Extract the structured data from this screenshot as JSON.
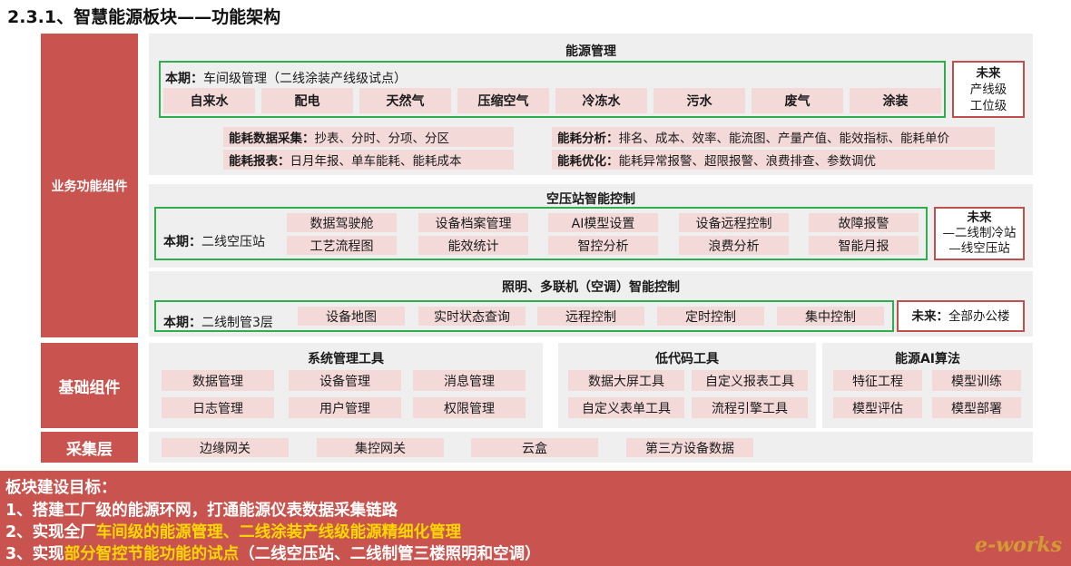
{
  "title": "2.3.1、智慧能源板块——功能架构",
  "side": {
    "business": "业务功能组件",
    "base": "基础组件",
    "collect": "采集层"
  },
  "energy": {
    "header": "能源管理",
    "current_prefix": "本期：",
    "current_text": "车间级管理（二线涂装产线级试点）",
    "items": [
      "自来水",
      "配电",
      "天然气",
      "压缩空气",
      "冷冻水",
      "污水",
      "废气",
      "涂装"
    ],
    "future_title": "未来",
    "future_line1": "产线级",
    "future_line2": "工位级",
    "collect_label": "能耗数据采集：",
    "collect_text": "抄表、分时、分项、分区",
    "report_label": "能耗报表：",
    "report_text": "日月年报、单车能耗、能耗成本",
    "analysis_label": "能耗分析：",
    "analysis_text": "排名、成本、效率、能流图、产量产值、能效指标、能耗单价",
    "optimize_label": "能耗优化：",
    "optimize_text": "能耗异常报警、超限报警、浪费排查、参数调优"
  },
  "air": {
    "header": "空压站智能控制",
    "current_prefix": "本期：",
    "current_text": "二线空压站",
    "row1": [
      "数据驾驶舱",
      "设备档案管理",
      "AI模型设置",
      "设备远程控制",
      "故障报警"
    ],
    "row2": [
      "工艺流程图",
      "能效统计",
      "智控分析",
      "浪费分析",
      "智能月报"
    ],
    "future_title": "未来",
    "future_line1": "—二线制冷站",
    "future_line2": "—线空压站"
  },
  "light": {
    "header": "照明、多联机（空调）智能控制",
    "current_prefix": "本期：",
    "current_text": "二线制管3层",
    "items": [
      "设备地图",
      "实时状态查询",
      "远程控制",
      "定时控制",
      "集中控制"
    ],
    "future_prefix": "未来：",
    "future_text": "全部办公楼"
  },
  "sys": {
    "header": "系统管理工具",
    "items": [
      "数据管理",
      "设备管理",
      "消息管理",
      "日志管理",
      "用户管理",
      "权限管理"
    ]
  },
  "lowcode": {
    "header": "低代码工具",
    "items": [
      "数据大屏工具",
      "自定义报表工具",
      "自定义表单工具",
      "流程引擎工具"
    ]
  },
  "ai": {
    "header": "能源AI算法",
    "items": [
      "特征工程",
      "模型训练",
      "模型评估",
      "模型部署"
    ]
  },
  "collect_items": [
    "边缘网关",
    "集控网关",
    "云盒",
    "第三方设备数据"
  ],
  "goals": {
    "heading": "板块建设目标：",
    "line1": "1、搭建工厂级的能源环网，打通能源仪表数据采集链路",
    "line2_a": "2、实现全厂",
    "line2_b": "车间级的能源管理、二线涂装产线级能源精细化管理",
    "line3_a": "3、实现",
    "line3_b": "部分智控节能功能的试点",
    "line3_c": "（二线空压站、二线制管三楼照明和空调）"
  },
  "logo": "e-works"
}
